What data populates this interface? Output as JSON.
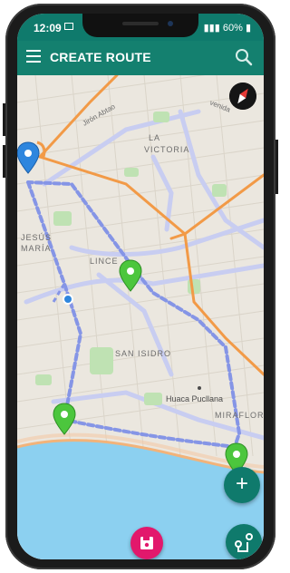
{
  "status": {
    "time": "12:09",
    "battery": "60%"
  },
  "appbar": {
    "title": "CREATE ROUTE"
  },
  "map": {
    "labels": {
      "jiron": "Jirón Abtao",
      "la": "LA",
      "victoria": "VICTORIA",
      "jesus": "JESÚS",
      "maria": "MARÍA",
      "lince": "LINCE",
      "san_isidro": "SAN ISIDRO",
      "huaca": "Huaca Pucllana",
      "miraflores": "MIRAFLOR",
      "avenida": "venida"
    }
  },
  "actions": {
    "add_icon": "plus-icon",
    "route_icon": "route-icon",
    "save_icon": "floppy-icon"
  },
  "colors": {
    "teal": "#14806f",
    "pin_green": "#4cc63d",
    "pin_blue": "#2e86de",
    "route": "#7b8ee6",
    "road": "#f29a47",
    "save": "#e2186c"
  }
}
